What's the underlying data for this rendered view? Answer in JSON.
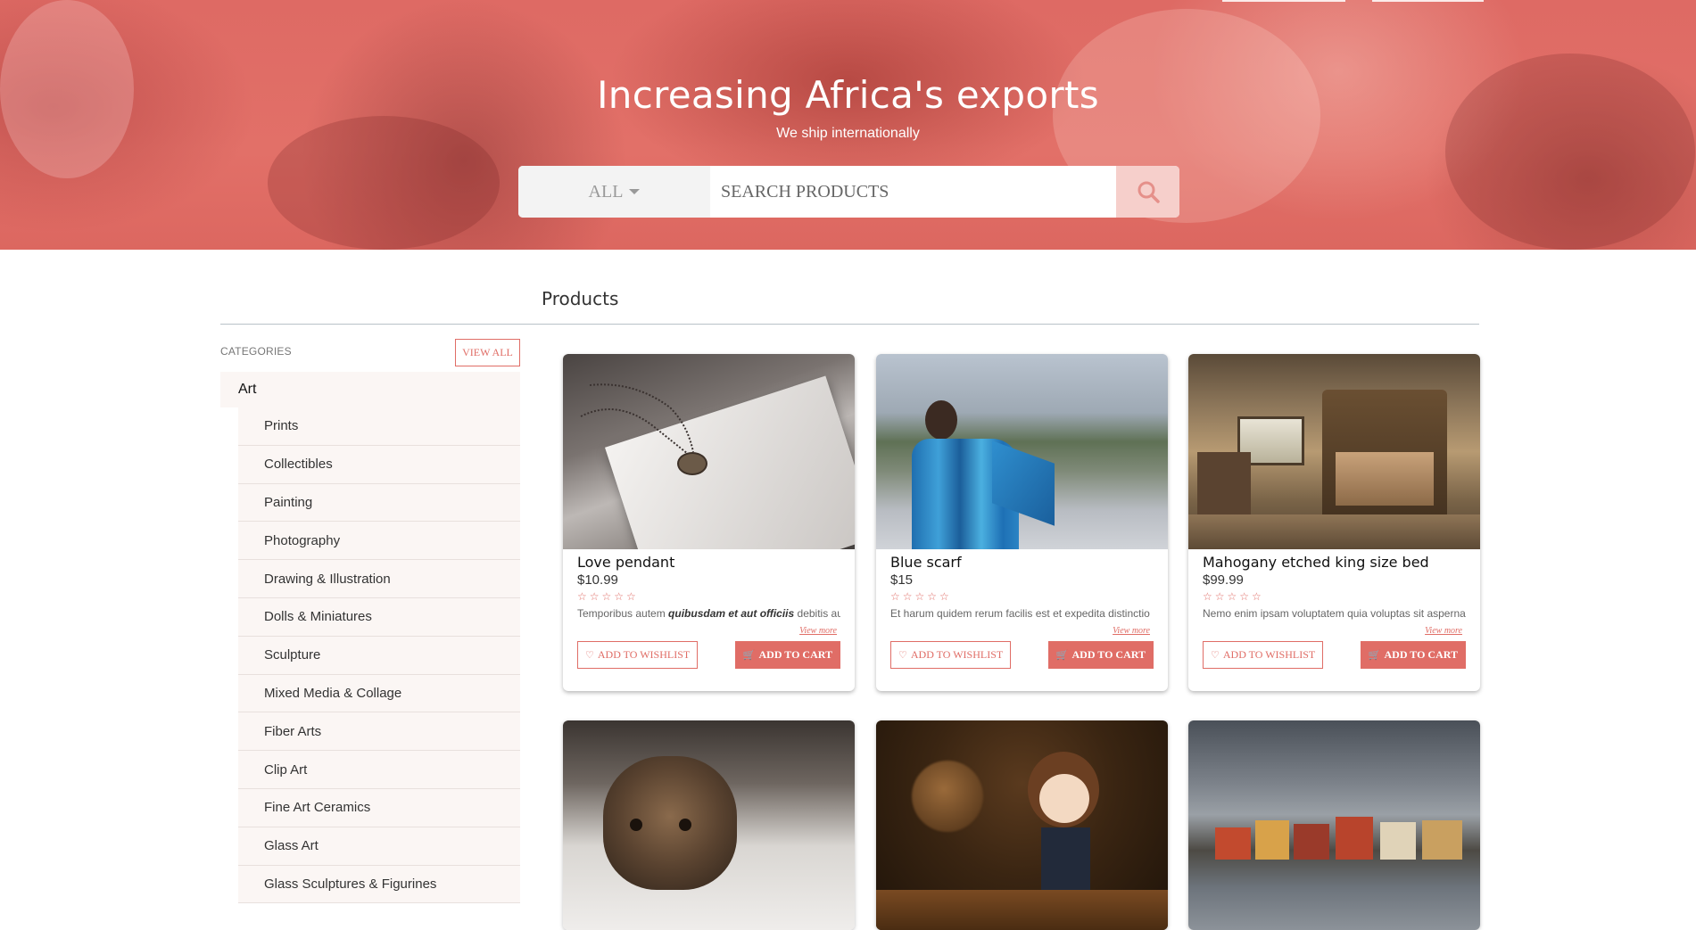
{
  "hero": {
    "title": "Increasing Africa's exports",
    "subtitle": "We ship internationally"
  },
  "search": {
    "category_label": "ALL",
    "placeholder": "SEARCH PRODUCTS",
    "button_icon": "search-icon"
  },
  "main": {
    "heading": "Products"
  },
  "sidebar": {
    "label": "CATEGORIES",
    "view_all": "VIEW ALL",
    "parent": "Art",
    "items": [
      {
        "label": "Prints"
      },
      {
        "label": "Collectibles"
      },
      {
        "label": "Painting"
      },
      {
        "label": "Photography"
      },
      {
        "label": "Drawing & Illustration"
      },
      {
        "label": "Dolls & Miniatures"
      },
      {
        "label": "Sculpture"
      },
      {
        "label": "Mixed Media & Collage"
      },
      {
        "label": "Fiber Arts"
      },
      {
        "label": "Clip Art"
      },
      {
        "label": "Fine Art Ceramics"
      },
      {
        "label": "Glass Art"
      },
      {
        "label": "Glass Sculptures & Figurines"
      }
    ]
  },
  "products": [
    {
      "name": "Love pendant",
      "price": "$10.99",
      "rating": 0,
      "desc_prefix": "Temporibus autem ",
      "desc_bold": "quibusdam et aut officiis",
      "desc_suffix": " debitis aut rerum necessitatibus",
      "more": "View more",
      "wishlist": "ADD TO WISHLIST",
      "cart": "ADD TO CART"
    },
    {
      "name": "Blue scarf",
      "price": "$15",
      "rating": 0,
      "desc_prefix": "Et harum quidem rerum facilis est et expedita distinctio",
      "desc_bold": "",
      "desc_suffix": "",
      "more": "View more",
      "wishlist": "ADD TO WISHLIST",
      "cart": "ADD TO CART"
    },
    {
      "name": "Mahogany etched king size bed",
      "price": "$99.99",
      "rating": 0,
      "desc_prefix": "Nemo enim ipsam voluptatem quia voluptas sit aspernatur",
      "desc_bold": "",
      "desc_suffix": "",
      "more": "View more",
      "wishlist": "ADD TO WISHLIST",
      "cart": "ADD TO CART"
    }
  ],
  "colors": {
    "accent": "#e06d66",
    "hero_overlay": "#e06d66",
    "sidebar_bg": "#fbf6f4"
  }
}
